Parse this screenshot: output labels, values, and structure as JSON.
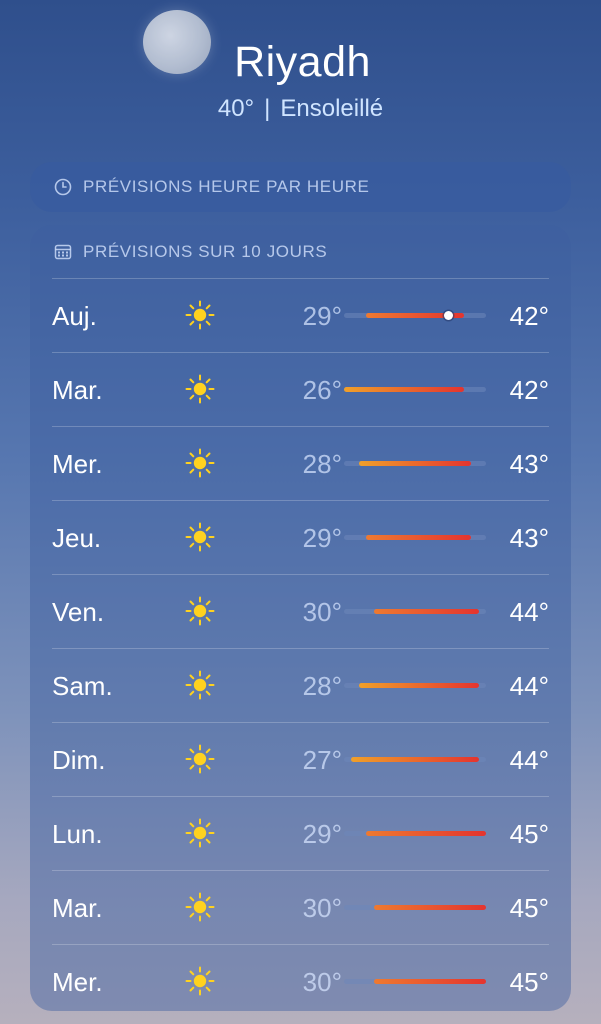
{
  "header": {
    "city": "Riyadh",
    "temp": "40°",
    "separator": "|",
    "condition": "Ensoleillé"
  },
  "hourly": {
    "title": "PRÉVISIONS HEURE PAR HEURE",
    "icon": "clock-icon"
  },
  "daily": {
    "title": "PRÉVISIONS SUR 10 JOURS",
    "icon": "calendar-icon",
    "range_min": 26,
    "range_max": 45,
    "current_temp": 40,
    "days": [
      {
        "day": "Auj.",
        "icon": "sun-icon",
        "low": "29°",
        "high": "42°",
        "low_val": 29,
        "high_val": 42
      },
      {
        "day": "Mar.",
        "icon": "sun-icon",
        "low": "26°",
        "high": "42°",
        "low_val": 26,
        "high_val": 42
      },
      {
        "day": "Mer.",
        "icon": "sun-icon",
        "low": "28°",
        "high": "43°",
        "low_val": 28,
        "high_val": 43
      },
      {
        "day": "Jeu.",
        "icon": "sun-icon",
        "low": "29°",
        "high": "43°",
        "low_val": 29,
        "high_val": 43
      },
      {
        "day": "Ven.",
        "icon": "sun-icon",
        "low": "30°",
        "high": "44°",
        "low_val": 30,
        "high_val": 44
      },
      {
        "day": "Sam.",
        "icon": "sun-icon",
        "low": "28°",
        "high": "44°",
        "low_val": 28,
        "high_val": 44
      },
      {
        "day": "Dim.",
        "icon": "sun-icon",
        "low": "27°",
        "high": "44°",
        "low_val": 27,
        "high_val": 44
      },
      {
        "day": "Lun.",
        "icon": "sun-icon",
        "low": "29°",
        "high": "45°",
        "low_val": 29,
        "high_val": 45
      },
      {
        "day": "Mar.",
        "icon": "sun-icon",
        "low": "30°",
        "high": "45°",
        "low_val": 30,
        "high_val": 45
      },
      {
        "day": "Mer.",
        "icon": "sun-icon",
        "low": "30°",
        "high": "45°",
        "low_val": 30,
        "high_val": 45
      }
    ]
  },
  "colors": {
    "sun": "#ffd21f",
    "warm": "#f0a02a",
    "hot": "#e4342f"
  }
}
